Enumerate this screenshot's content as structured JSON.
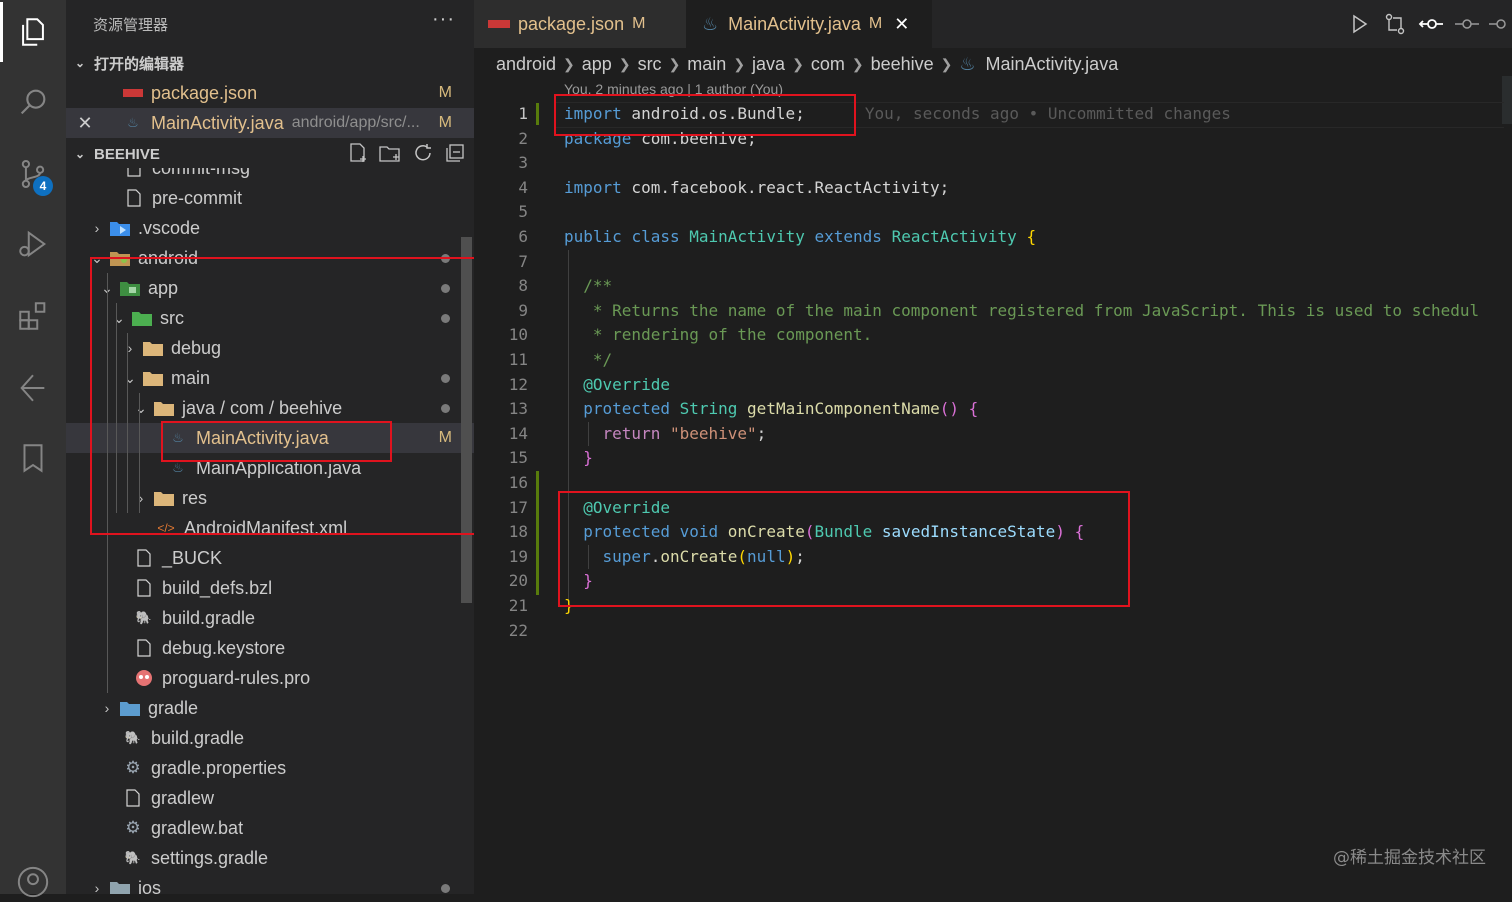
{
  "activity_bar": {
    "source_control_badge": "4",
    "icons": [
      "explorer-icon",
      "search-icon",
      "source-control-icon",
      "run-debug-icon",
      "extensions-icon",
      "remote-icon",
      "bookmark-icon",
      "account-icon"
    ]
  },
  "sidebar": {
    "title": "资源管理器",
    "more": "···",
    "open_editors_header": "打开的编辑器",
    "open_editors": [
      {
        "name": "package.json",
        "status": "M"
      },
      {
        "name": "MainActivity.java",
        "path": "android/app/src/...",
        "status": "M"
      }
    ],
    "workspace_header": "BEEHIVE",
    "tree": [
      {
        "name": "commit-msg"
      },
      {
        "name": "pre-commit"
      },
      {
        "name": ".vscode"
      },
      {
        "name": "android"
      },
      {
        "name": "app"
      },
      {
        "name": "src"
      },
      {
        "name": "debug"
      },
      {
        "name": "main"
      },
      {
        "name": "java / com / beehive"
      },
      {
        "name": "MainActivity.java",
        "status": "M"
      },
      {
        "name": "MainApplication.java"
      },
      {
        "name": "res"
      },
      {
        "name": "AndroidManifest.xml"
      },
      {
        "name": "_BUCK"
      },
      {
        "name": "build_defs.bzl"
      },
      {
        "name": "build.gradle"
      },
      {
        "name": "debug.keystore"
      },
      {
        "name": "proguard-rules.pro"
      },
      {
        "name": "gradle"
      },
      {
        "name": "build.gradle"
      },
      {
        "name": "gradle.properties"
      },
      {
        "name": "gradlew"
      },
      {
        "name": "gradlew.bat"
      },
      {
        "name": "settings.gradle"
      },
      {
        "name": "ios"
      }
    ]
  },
  "editor": {
    "tabs": [
      {
        "name": "package.json",
        "status": "M"
      },
      {
        "name": "MainActivity.java",
        "status": "M",
        "close": "✕"
      }
    ],
    "breadcrumb": [
      "android",
      "app",
      "src",
      "main",
      "java",
      "com",
      "beehive",
      "MainActivity.java"
    ],
    "codelens": "You, 2 minutes ago | 1 author (You)",
    "blame": "You, seconds ago • Uncommitted changes",
    "line_numbers": [
      "1",
      "2",
      "3",
      "4",
      "5",
      "6",
      "7",
      "8",
      "9",
      "10",
      "11",
      "12",
      "13",
      "14",
      "15",
      "16",
      "17",
      "18",
      "19",
      "20",
      "21",
      "22"
    ]
  },
  "watermark": "@稀土掘金技术社区",
  "colors": {
    "accent_red_box": "#e0131e",
    "modified": "#e2c08d",
    "git_added": "#587c0c"
  }
}
